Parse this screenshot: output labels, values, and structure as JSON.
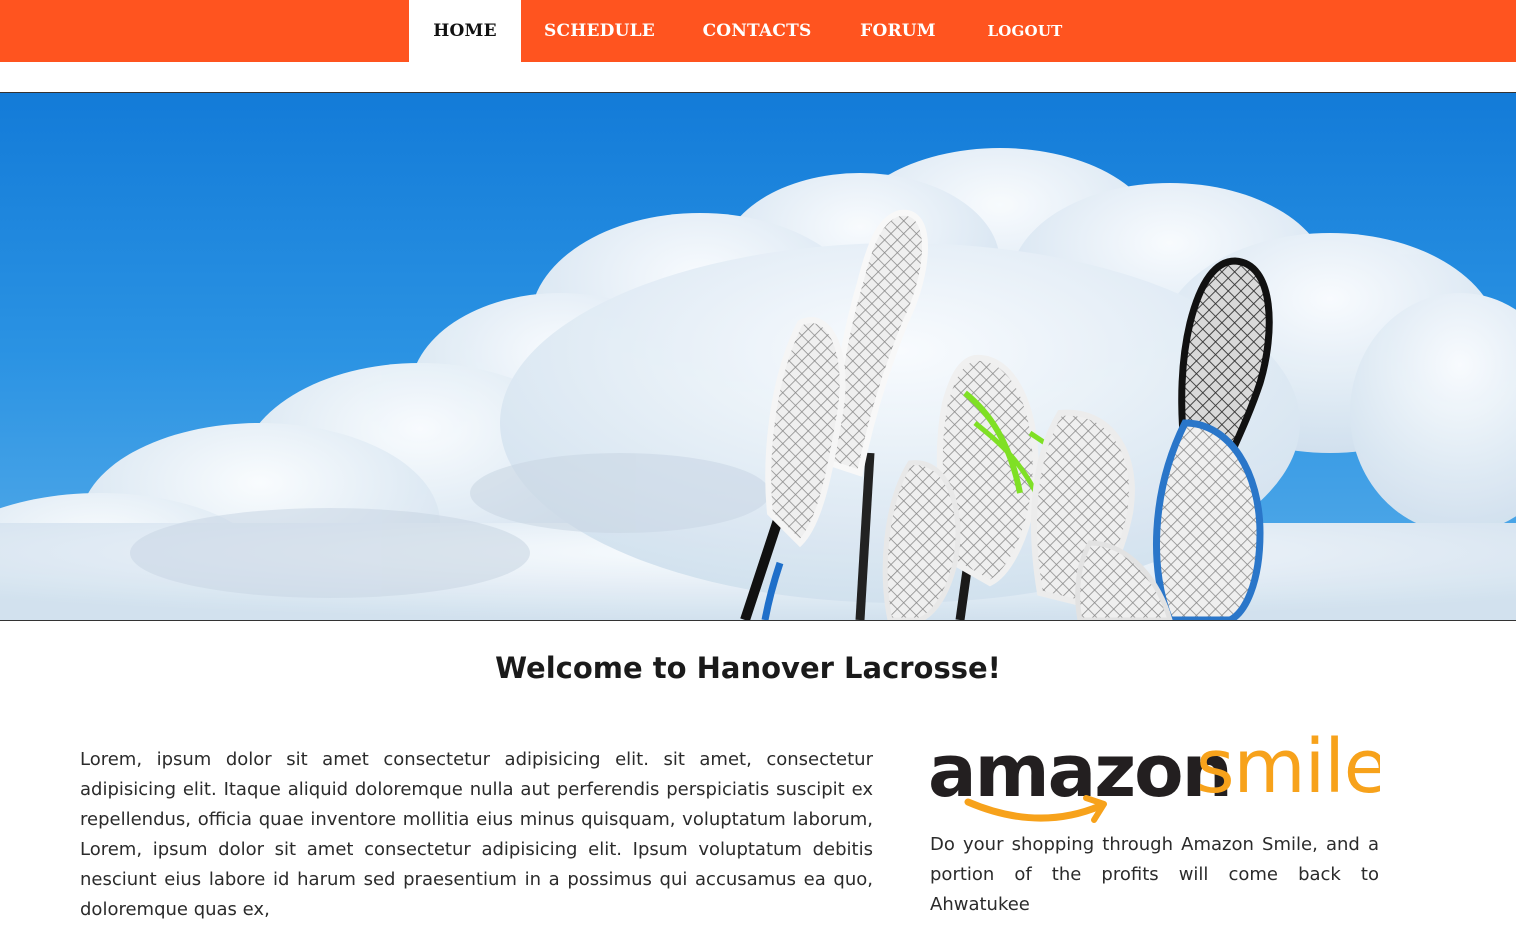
{
  "nav": {
    "items": [
      {
        "label": "HOME",
        "active": true
      },
      {
        "label": "SCHEDULE",
        "active": false
      },
      {
        "label": "CONTACTS",
        "active": false
      },
      {
        "label": "FORUM",
        "active": false
      },
      {
        "label": "LOGOUT",
        "active": false
      }
    ]
  },
  "hero": {
    "image": "lacrosse-sticks-against-sky"
  },
  "main": {
    "title": "Welcome to Hanover Lacrosse!",
    "body": "Lorem, ipsum dolor sit amet consectetur adipisicing elit. sit amet, consectetur adipisicing elit. Itaque aliquid doloremque nulla aut perferendis perspiciatis suscipit ex repellendus, officia quae inventore mollitia eius minus quisquam, voluptatum laborum, Lorem, ipsum dolor sit amet consectetur adipisicing elit. Ipsum voluptatum debitis nesciunt eius labore id harum sed praesentium in a possimus qui accusamus ea quo, doloremque quas ex,"
  },
  "sidebar": {
    "logo_word_1": "amazon",
    "logo_word_2": "smile",
    "text": "Do your shopping through Amazon Smile, and a portion of the profits will come back to Ahwatukee"
  },
  "colors": {
    "nav_bg": "#ff541f",
    "amazon_orange": "#f7a21b",
    "amazon_dark": "#231f20"
  }
}
